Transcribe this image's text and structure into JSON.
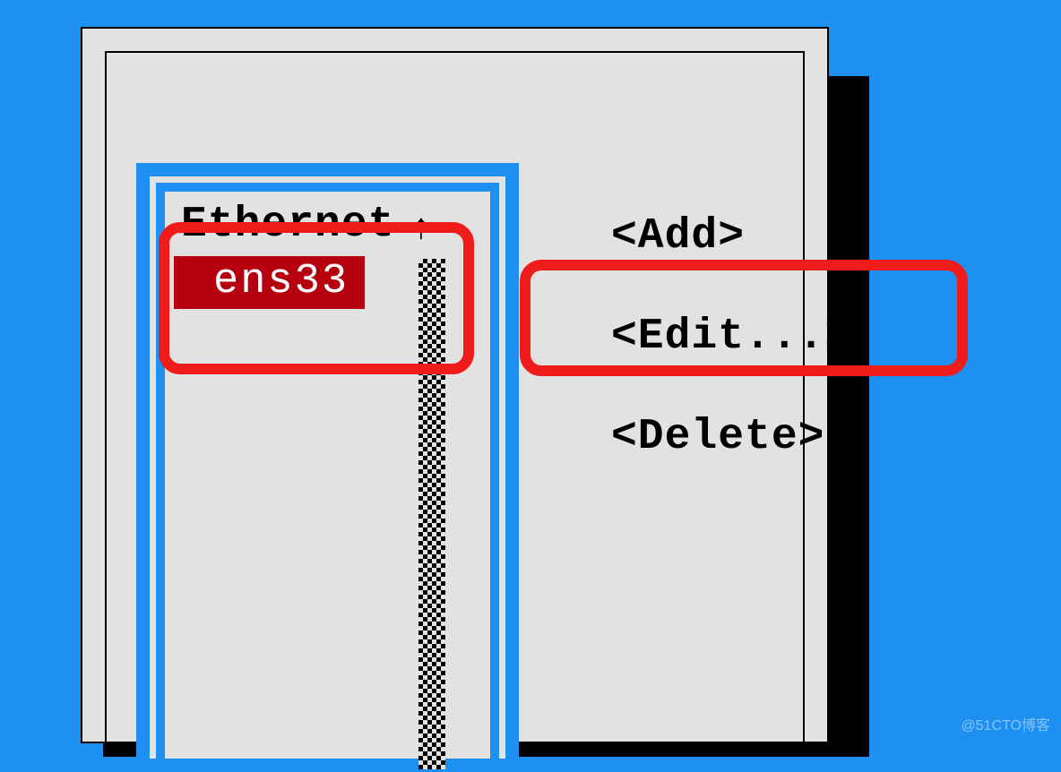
{
  "list": {
    "header": "Ethernet",
    "selected": "ens33",
    "scroll_indicator": "↑"
  },
  "actions": {
    "add": "<Add>",
    "edit": "<Edit...>",
    "delete": "<Delete>"
  },
  "watermark": "@51CTO博客"
}
